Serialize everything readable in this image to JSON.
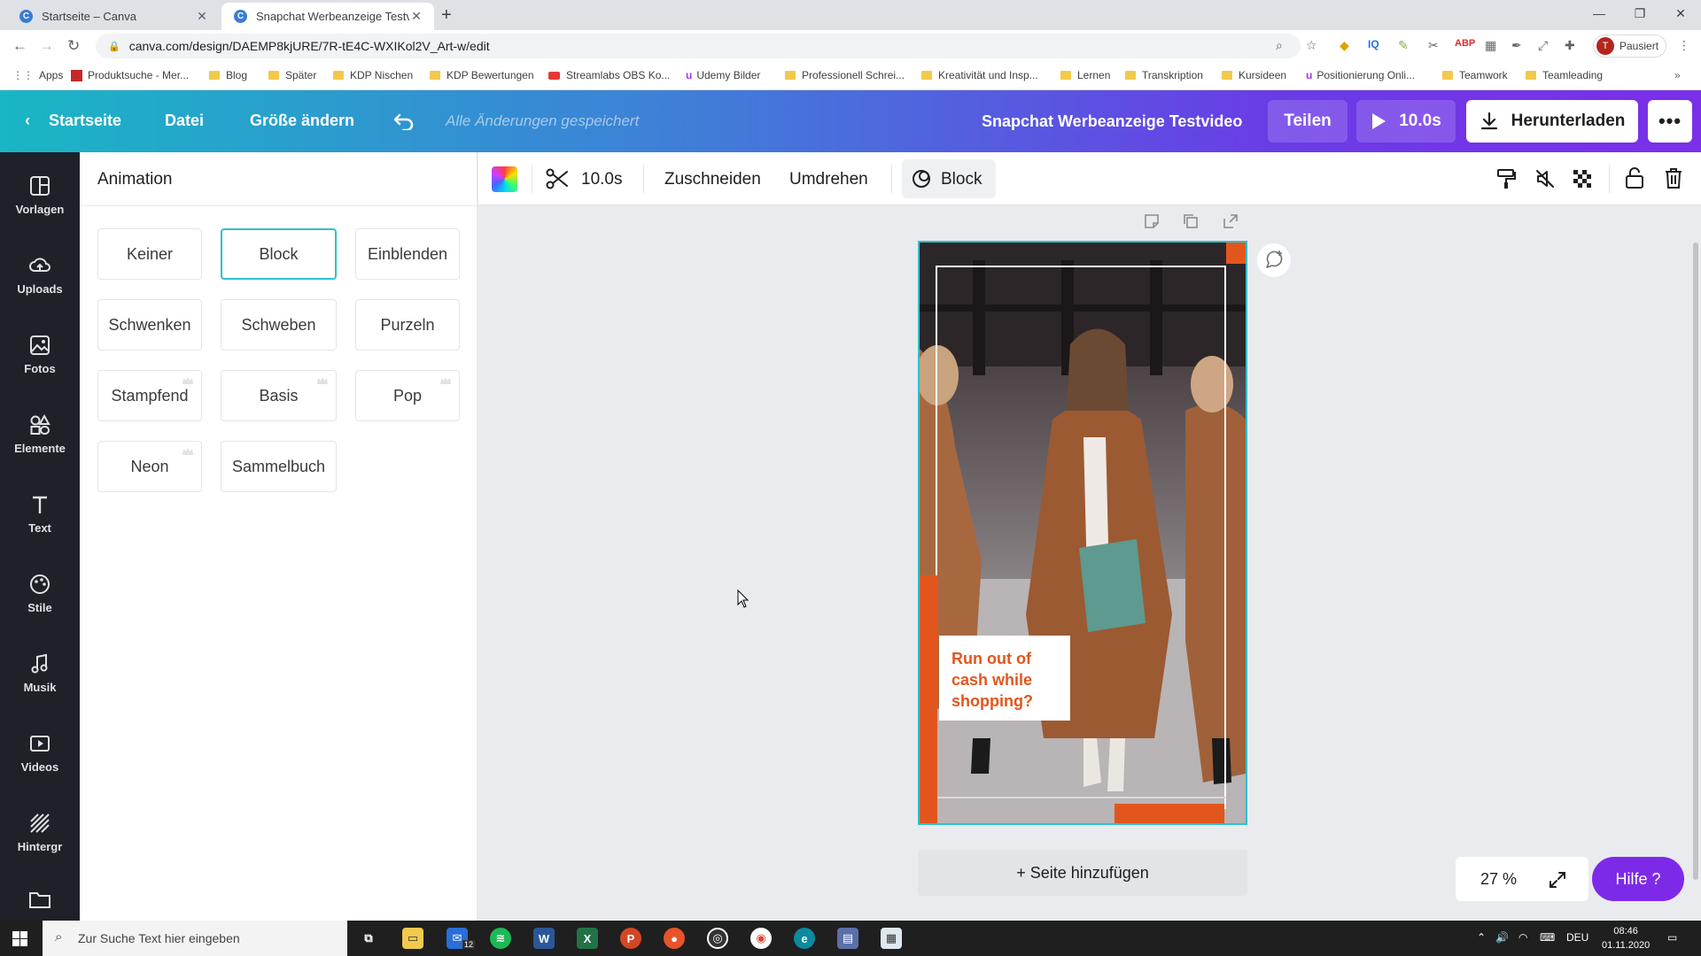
{
  "browser": {
    "tabs": [
      {
        "title": "Startseite – Canva"
      },
      {
        "title": "Snapchat Werbeanzeige Testvideo"
      }
    ],
    "url": "canva.com/design/DAEMP8kjURE/7R-tE4C-WXIKol2V_Art-w/edit",
    "profile_initial": "T",
    "profile_label": "Pausiert",
    "bookmarks": [
      "Apps",
      "Produktsuche - Mer...",
      "Blog",
      "Später",
      "KDP Nischen",
      "KDP Bewertungen",
      "Streamlabs OBS Ko...",
      "Udemy Bilder",
      "Professionell Schrei...",
      "Kreativität und Insp...",
      "Lernen",
      "Transkription",
      "Kursideen",
      "Positionierung Onli...",
      "Teamwork",
      "Teamleading"
    ]
  },
  "header": {
    "home": "Startseite",
    "file": "Datei",
    "resize": "Größe ändern",
    "saved_status": "Alle Änderungen gespeichert",
    "doc_title": "Snapchat Werbeanzeige Testvideo",
    "share": "Teilen",
    "play_duration": "10.0s",
    "download": "Herunterladen",
    "more": "•••"
  },
  "sidebar": {
    "items": [
      {
        "label": "Vorlagen",
        "icon": "templates-icon"
      },
      {
        "label": "Uploads",
        "icon": "upload-icon"
      },
      {
        "label": "Fotos",
        "icon": "photos-icon"
      },
      {
        "label": "Elemente",
        "icon": "elements-icon"
      },
      {
        "label": "Text",
        "icon": "text-icon"
      },
      {
        "label": "Stile",
        "icon": "styles-icon"
      },
      {
        "label": "Musik",
        "icon": "music-icon"
      },
      {
        "label": "Videos",
        "icon": "videos-icon"
      },
      {
        "label": "Hintergr",
        "icon": "background-icon"
      }
    ]
  },
  "panel": {
    "title": "Animation",
    "options": [
      {
        "label": "Keiner",
        "selected": false,
        "premium": false
      },
      {
        "label": "Block",
        "selected": true,
        "premium": false
      },
      {
        "label": "Einblenden",
        "selected": false,
        "premium": false
      },
      {
        "label": "Schwenken",
        "selected": false,
        "premium": false
      },
      {
        "label": "Schweben",
        "selected": false,
        "premium": false
      },
      {
        "label": "Purzeln",
        "selected": false,
        "premium": false
      },
      {
        "label": "Stampfend",
        "selected": false,
        "premium": true
      },
      {
        "label": "Basis",
        "selected": false,
        "premium": true
      },
      {
        "label": "Pop",
        "selected": false,
        "premium": true
      },
      {
        "label": "Neon",
        "selected": false,
        "premium": true
      },
      {
        "label": "Sammelbuch",
        "selected": false,
        "premium": false
      }
    ]
  },
  "toolbar": {
    "duration": "10.0s",
    "crop": "Zuschneiden",
    "flip": "Umdrehen",
    "animation": "Block"
  },
  "canvas": {
    "caption": "Run out of cash while shopping?",
    "add_page": "+ Seite hinzufügen",
    "zoom": "27 %",
    "help": "Hilfe ?"
  },
  "taskbar": {
    "search_placeholder": "Zur Suche Text hier eingeben",
    "language": "DEU",
    "time": "08:46",
    "date": "01.11.2020",
    "mail_badge": "12"
  },
  "colors": {
    "accent_teal": "#2ec1cf",
    "caption_orange": "#e2561d",
    "help_purple": "#7d2ae8",
    "sidebar_dark": "#1e2128"
  }
}
